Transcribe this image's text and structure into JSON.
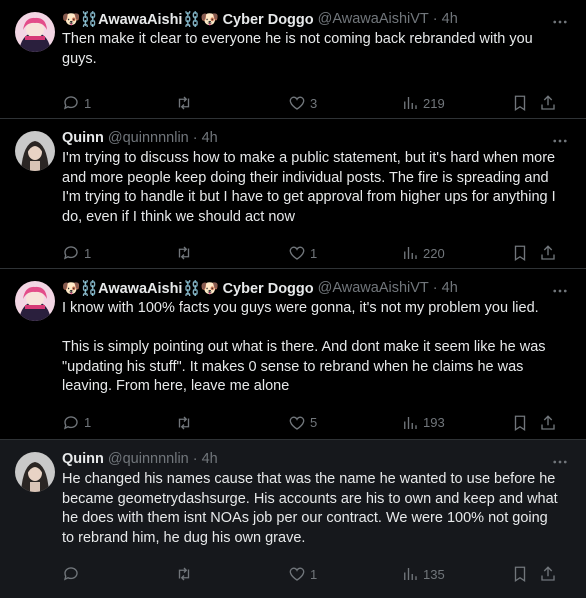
{
  "tweets": [
    {
      "display_name": "🐶⛓️AwawaAishi⛓️🐶 Cyber Doggo",
      "handle": "@AwawaAishiVT",
      "time": "4h",
      "text": "Then make it clear to everyone he is not coming back rebranded with you guys.",
      "replies": "1",
      "retweets": "",
      "likes": "3",
      "views": "219"
    },
    {
      "display_name": "Quinn",
      "handle": "@quinnnnlin",
      "time": "4h",
      "text": "I'm trying to discuss how to make a public statement, but it's hard when more and more people keep doing their individual posts. The fire is spreading and I'm trying to handle it but I have to get approval from higher ups for anything I do, even if I think we should act now",
      "replies": "1",
      "retweets": "",
      "likes": "1",
      "views": "220"
    },
    {
      "display_name": "🐶⛓️AwawaAishi⛓️🐶 Cyber Doggo",
      "handle": "@AwawaAishiVT",
      "time": "4h",
      "text": "I know with 100% facts you guys were gonna, it's not my problem you lied.\n\nThis is simply pointing out what is there. And dont make it seem like he was \"updating his stuff\". It makes 0 sense to rebrand when he claims he was leaving. From here, leave me alone",
      "replies": "1",
      "retweets": "",
      "likes": "5",
      "views": "193"
    },
    {
      "display_name": "Quinn",
      "handle": "@quinnnnlin",
      "time": "4h",
      "text": "He changed his names cause that was the name he wanted to use before he became geometrydashsurge. His accounts are his to own and keep and what he does with them isnt NOAs job per our contract. We were 100% not going to rebrand him, he dug his own grave.",
      "replies": "",
      "retweets": "",
      "likes": "1",
      "views": "135"
    }
  ],
  "icons": {
    "reply": "reply-icon",
    "retweet": "retweet-icon",
    "like": "heart-icon",
    "views": "views-icon",
    "bookmark": "bookmark-icon",
    "share": "share-icon",
    "more": "more-icon"
  },
  "colors": {
    "background": "#000000",
    "dim_background": "#16181c",
    "text": "#e7e9ea",
    "secondary": "#71767b",
    "divider": "#2f3336"
  }
}
